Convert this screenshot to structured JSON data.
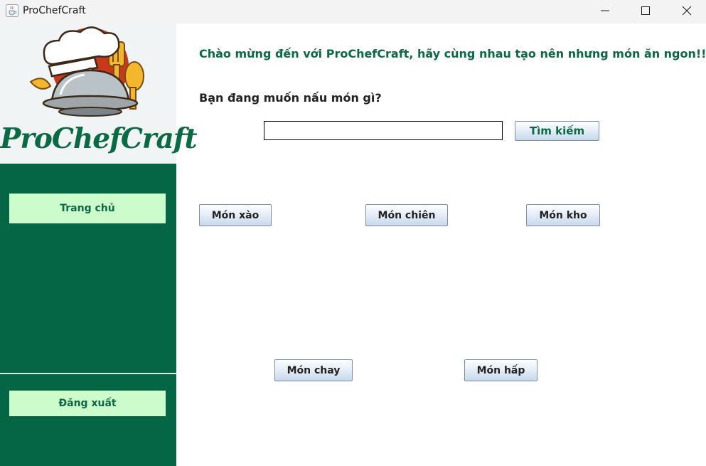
{
  "window": {
    "title": "ProChefCraft",
    "icons": {
      "app": "java-cup-icon",
      "minimize": "minimize-icon",
      "maximize": "maximize-icon",
      "close": "close-icon"
    }
  },
  "sidebar": {
    "logo_text": "ProChefCraft",
    "logo_icon": "chef-hat-cloche-logo",
    "home_label": "Trang chủ",
    "logout_label": "Đăng xuất",
    "colors": {
      "background": "#046645",
      "button": "#ccfccb",
      "text": "#0a6a44"
    }
  },
  "main": {
    "welcome": "Chào mừng đến với ProChefCraft, hãy cùng nhau tạo nên nhưng món ăn ngon!!!",
    "question": "Bạn đang muốn nấu món gì?",
    "search": {
      "value": "",
      "placeholder": "",
      "button_label": "Tìm kiếm"
    },
    "categories": {
      "stir_fry": "Món xào",
      "fried": "Món chiên",
      "braised": "Món kho",
      "vegetarian": "Món chay",
      "steamed": "Món hấp"
    }
  }
}
